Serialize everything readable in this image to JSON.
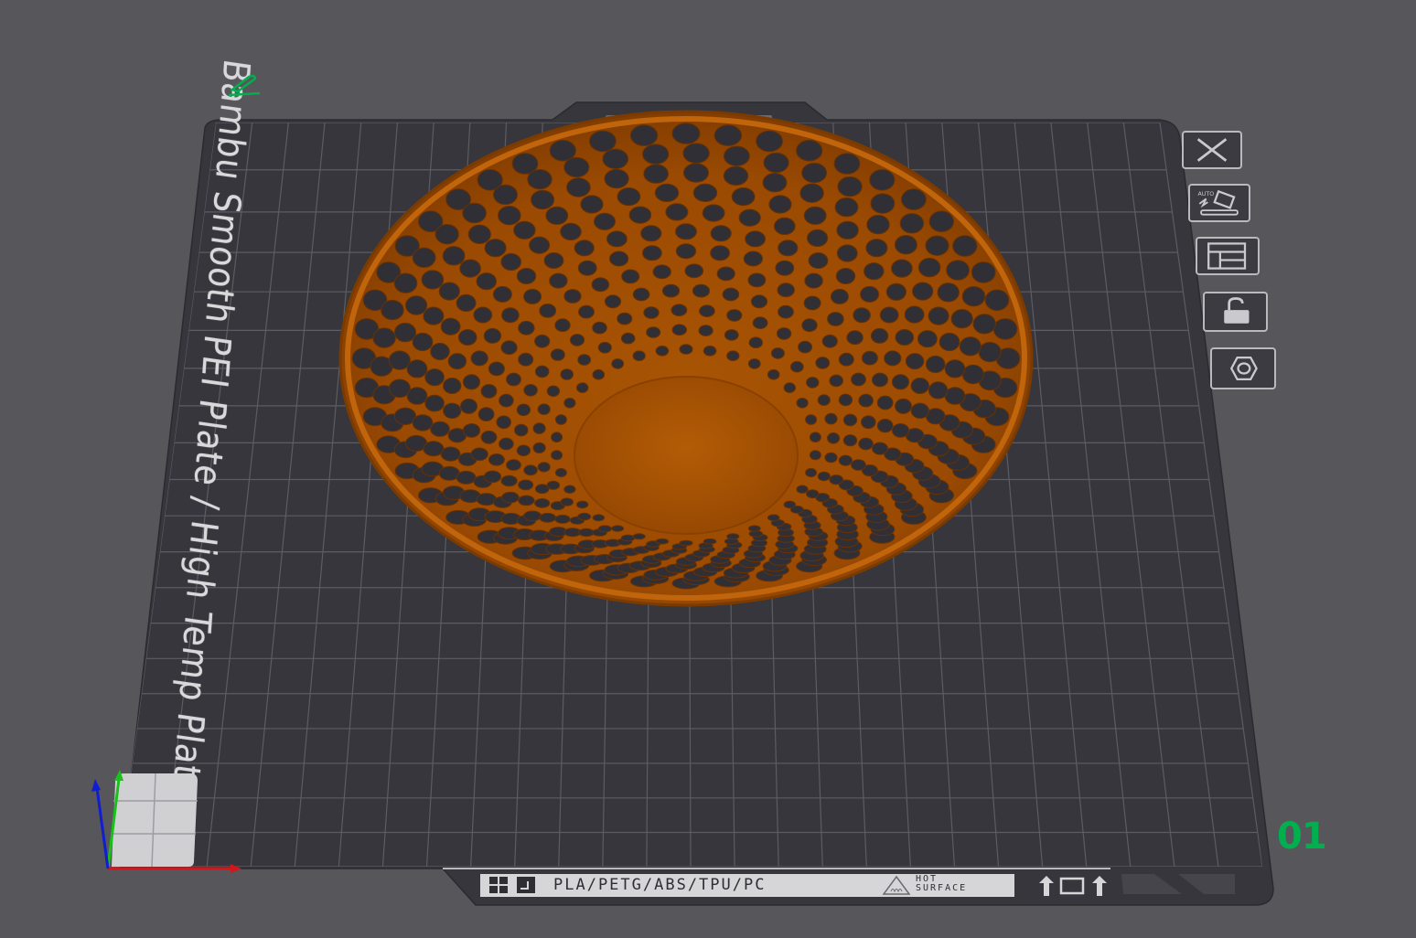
{
  "plate": {
    "label": "Bambu Smooth PEI Plate / High Temp Plate",
    "number": "01",
    "legend": {
      "materials": "PLA/PETG/ABS/TPU/PC",
      "hot_surface": "HOT\nSURFACE"
    }
  },
  "plate_toolbar": {
    "items": [
      {
        "name": "remove-plate-button",
        "icon": "close-icon"
      },
      {
        "name": "auto-orient-button",
        "icon": "auto-orient-icon"
      },
      {
        "name": "arrange-button",
        "icon": "arrange-icon"
      },
      {
        "name": "lock-plate-button",
        "icon": "lock-icon"
      },
      {
        "name": "plate-settings-button",
        "icon": "hexagon-settings-icon"
      }
    ]
  },
  "colors": {
    "background": "#56565b",
    "plate": "#36363c",
    "grid": "#5c5c63",
    "model": "#b05a08",
    "accent_green": "#00b04f"
  }
}
